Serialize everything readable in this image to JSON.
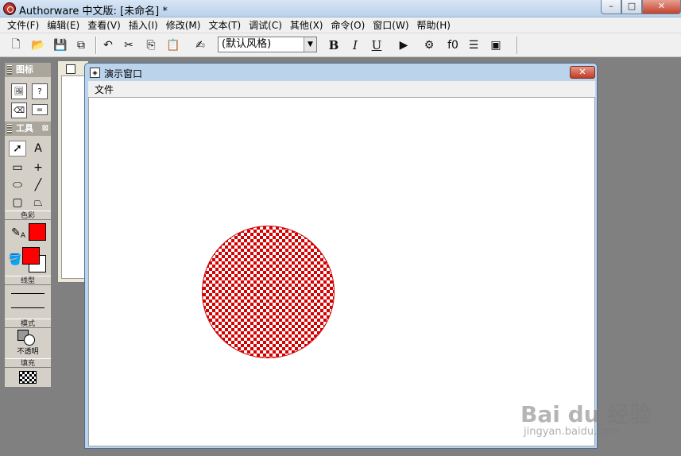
{
  "app": {
    "title": "Authorware 中文版: [未命名] *",
    "window_controls": {
      "minimize": "–",
      "maximize": "□",
      "close": "✕"
    }
  },
  "menubar": {
    "items": [
      "文件(F)",
      "编辑(E)",
      "查看(V)",
      "插入(I)",
      "修改(M)",
      "文本(T)",
      "调试(C)",
      "其他(X)",
      "命令(O)",
      "窗口(W)",
      "帮助(H)"
    ]
  },
  "toolbar": {
    "style_value": "(默认风格)",
    "bold": "B",
    "italic": "I",
    "underline": "U"
  },
  "icon_palette": {
    "header": "图标",
    "tools_header": "工具",
    "colors_label": "色彩",
    "linetype_label": "线型",
    "mode_label": "模式",
    "mode_value": "不透明",
    "fill_label": "填充",
    "colors": {
      "line": "#ff0000",
      "fill_fore": "#ff0000",
      "fill_back": "#ffffff"
    }
  },
  "presentation_window": {
    "title": "演示窗口",
    "menu_item": "文件",
    "circle": {
      "fill_color": "#d40000",
      "pattern": "checker"
    }
  },
  "watermark": {
    "brand": "Bai du 经验",
    "url": "jingyan.baidu.com"
  }
}
